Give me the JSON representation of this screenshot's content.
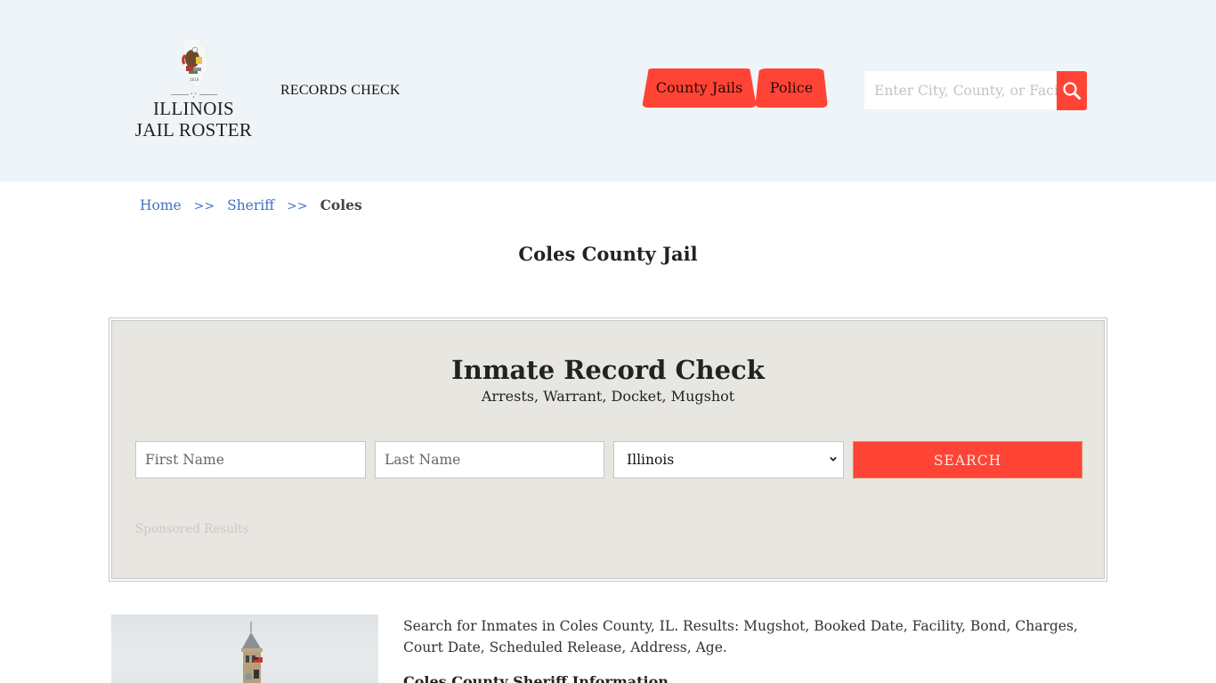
{
  "header": {
    "logo": {
      "line1": "ILLINOIS",
      "line2": "JAIL ROSTER",
      "seal_icon": "illinois-state-seal"
    },
    "records_check_link": "RECORDS CHECK",
    "nav": [
      {
        "label": "County Jails"
      },
      {
        "label": "Police"
      }
    ],
    "site_search": {
      "placeholder": "Enter City, County, or Facility",
      "value": ""
    },
    "colors": {
      "accent": "#ff4436",
      "header_bg": "#eff4f8"
    }
  },
  "breadcrumb": {
    "items": [
      {
        "label": "Home"
      },
      {
        "label": "Sheriff"
      },
      {
        "label": "Coles"
      }
    ],
    "separator": ">>"
  },
  "page_title": "Coles County Jail",
  "record_check": {
    "title": "Inmate Record Check",
    "subtitle": "Arrests, Warrant, Docket, Mugshot",
    "first_name": {
      "placeholder": "First Name",
      "value": ""
    },
    "last_name": {
      "placeholder": "Last Name",
      "value": ""
    },
    "state_select": {
      "selected": "Illinois"
    },
    "search_button": "SEARCH",
    "sponsored_label": "Sponsored Results"
  },
  "content": {
    "image_alt": "Coles County courthouse clock tower",
    "description": "Search for Inmates in Coles County, IL. Results: Mugshot, Booked Date, Facility, Bond, Charges, Court Date, Scheduled Release, Address, Age.",
    "section_heading": "Coles County Sheriff Information"
  }
}
